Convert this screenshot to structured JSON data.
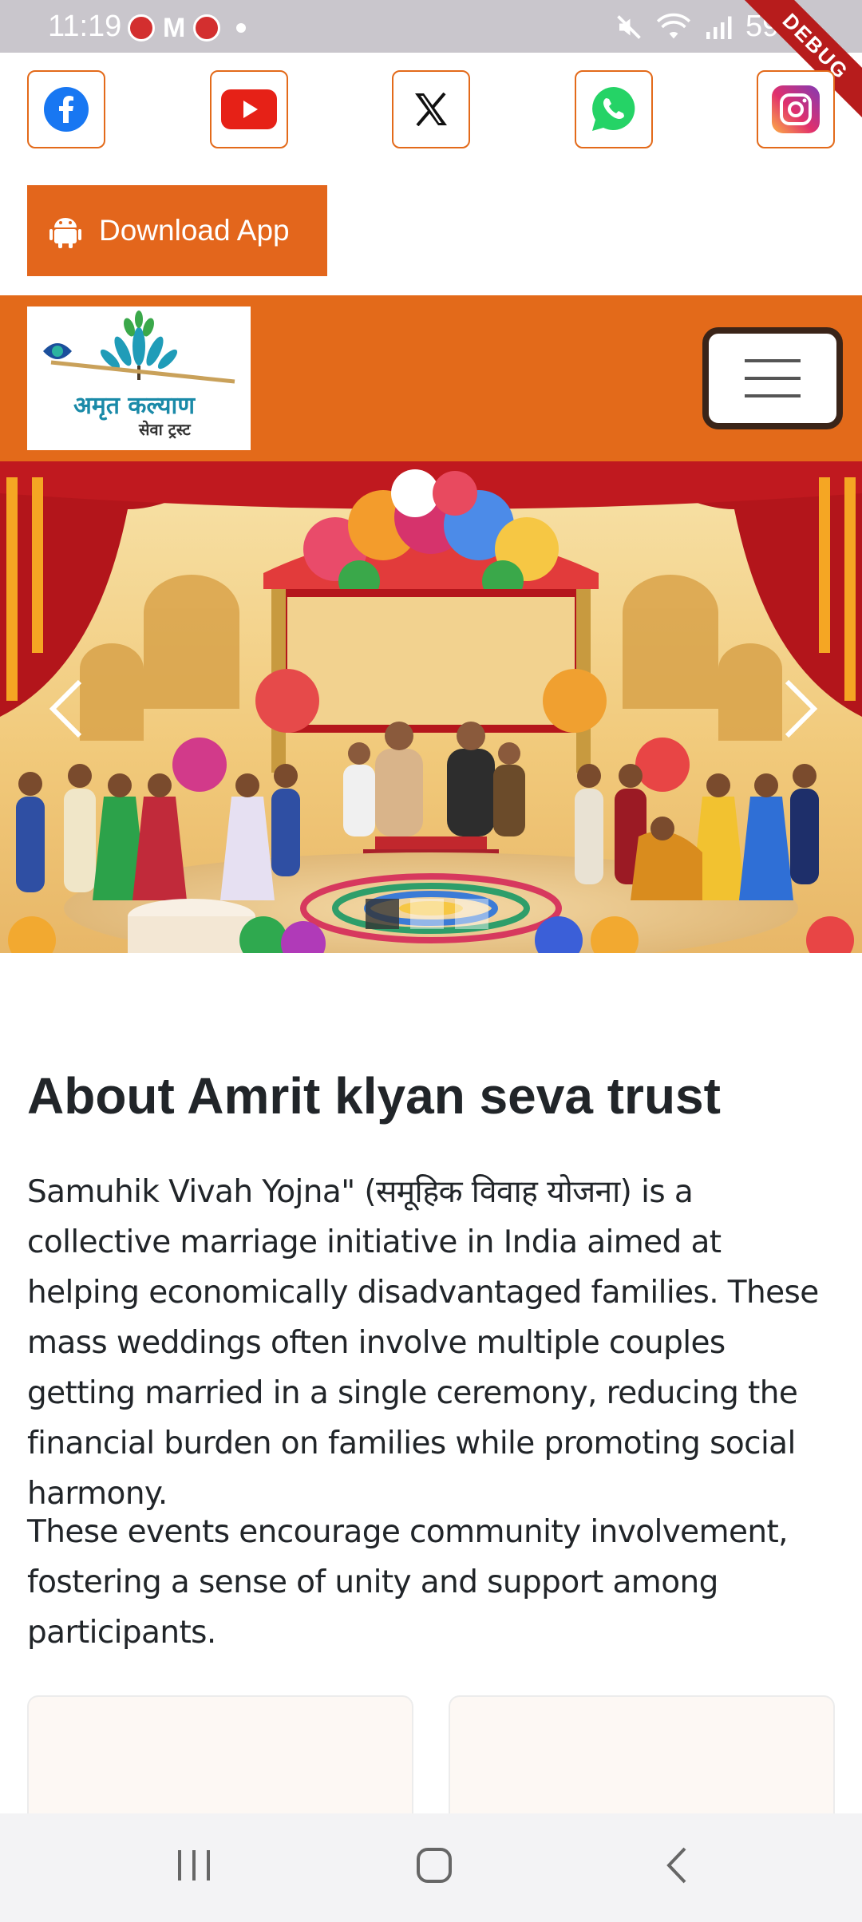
{
  "status_bar": {
    "time": "11:19",
    "battery": "59%",
    "debug_label": "DEBUG"
  },
  "social": [
    {
      "name": "facebook",
      "color": "#1877f2"
    },
    {
      "name": "youtube",
      "color": "#e62117"
    },
    {
      "name": "x",
      "color": "#000000"
    },
    {
      "name": "whatsapp",
      "color": "#25d366"
    },
    {
      "name": "instagram",
      "color": "#c13584"
    }
  ],
  "download": {
    "label": "Download App",
    "icon": "android-icon"
  },
  "brand": {
    "logo_text": "अमृत कल्याण",
    "logo_sub": "सेवा ट्रस्ट",
    "accent": "#e36a1a"
  },
  "carousel": {
    "slide_count": 3,
    "active_index": 0
  },
  "about": {
    "title": "About Amrit klyan seva trust",
    "p1": "Samuhik Vivah Yojna\" (समूहिक विवाह योजना) is a collective marriage initiative in India aimed at helping economically disadvantaged families. These mass weddings often involve multiple couples getting married in a single ceremony, reducing the financial burden on families while promoting social harmony.",
    "p2": "These events encourage community involvement, fostering a sense of unity and support among participants."
  }
}
